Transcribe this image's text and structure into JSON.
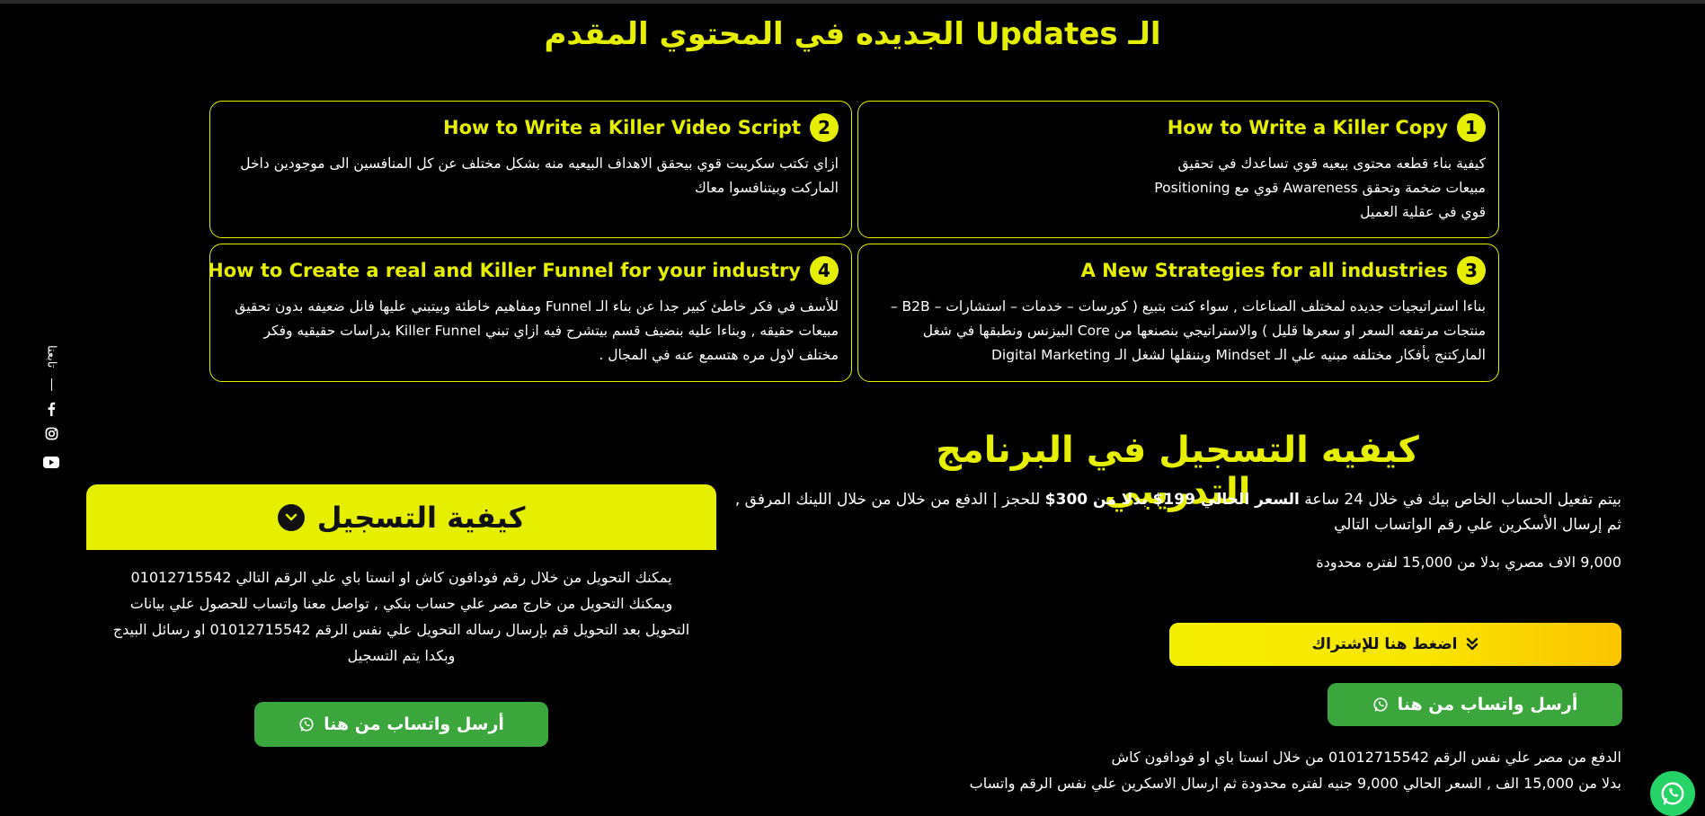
{
  "updates": {
    "title": "الـ Updates الجديده في المحتوي المقدم",
    "cards": [
      {
        "number": "1",
        "title": "How to Write a Killer Copy",
        "text": "كيفية بناء قطعه محتوى بيعيه قوي تساعدك في تحقيق مبيعات ضخمة وتحقق Awareness قوي مع Positioning قوي في عقلية العميل"
      },
      {
        "number": "2",
        "title": "How to Write a Killer Video Script",
        "text": "ازاي تكتب سكريبت قوي بيحقق الاهداف البيعيه منه بشكل مختلف عن كل المنافسين الى موجودين داخل الماركت وبيتنافسوا معاك"
      },
      {
        "number": "3",
        "title": "A New Strategies for all industries",
        "text": "بناءا استراتيجيات جديده لمختلف الصناعات , سواء كنت بتبيع ( كورسات – خدمات – استشارات – B2B – منتجات مرتفعه السعر او سعرها قليل ) والاستراتيجي بنصنعها من Core البيزنس ونطبقها في شغل الماركتنج بأفكار مختلفه مبنيه علي الـ Mindset وبننقلها لشغل الـ Digital Marketing"
      },
      {
        "number": "4",
        "title": "How to Create a real and Killer Funnel for your industry",
        "text": "للأسف في فكر خاطئ كبير جدا عن بناء الـ Funnel ومفاهيم خاطئة وبيتبني عليها فانل ضعيفه بدون تحقيق مبيعات حقيقه , وبناءا عليه بنضيف قسم بيتشرح فيه ازاي تبني Killer Funnel بدراسات حقيقيه وفكر مختلف لاول مره هتسمع عنه في المجال ."
      }
    ]
  },
  "social": {
    "follow_label": "تابعنا",
    "icons": [
      "facebook-icon",
      "instagram-icon",
      "youtube-icon"
    ]
  },
  "registration": {
    "title": "كيفيه التسجيل في البرنامج التدريبي",
    "p1_before": "بيتم تفعيل الحساب الخاص بيك في خلال 24 ساعة ",
    "p1_bold": " السعر الحالي 199$ بدلا من 300$",
    "p1_after": " للحجز | الدفع من خلال من خلال اللينك المرفق , ثم إرسال الأسكرين علي رقم الواتساب التالي",
    "p2": "9,000 الاف مصري بدلا من 15,000 لفتره محدودة",
    "subscribe_label": "اضغط هنا للإشتراك",
    "whatsapp_label": "أرسل واتساب من هنا",
    "p3_line1": "الدفع من مصر علي نفس الرقم 01012715542 من خلال انستا باي او فودافون كاش",
    "p3_line2": "بدلا من 15,000 الف , السعر الحالي 9,000 جنيه لفتره محدودة  ثم ارسال الاسكرين علي نفس الرقم واتساب"
  },
  "how_panel": {
    "title": "كيفية التسجيل",
    "lines": [
      "يمكنك التحويل من خلال رقم فودافون كاش او انستا باي علي الرقم التالي 01012715542",
      "ويمكنك التحويل من خارج مصر علي حساب بنكي , تواصل معنا واتساب للحصول علي بيانات",
      "التحويل بعد التحويل قم بإرسال رساله التحويل علي نفس الرقم 01012715542 او رسائل البيدج",
      "وبكدا يتم التسجيل"
    ],
    "whatsapp_label": "أرسل واتساب من هنا"
  },
  "colors": {
    "accent": "#e6ef00",
    "whatsapp_green": "#3aa63c",
    "background": "#000000"
  }
}
